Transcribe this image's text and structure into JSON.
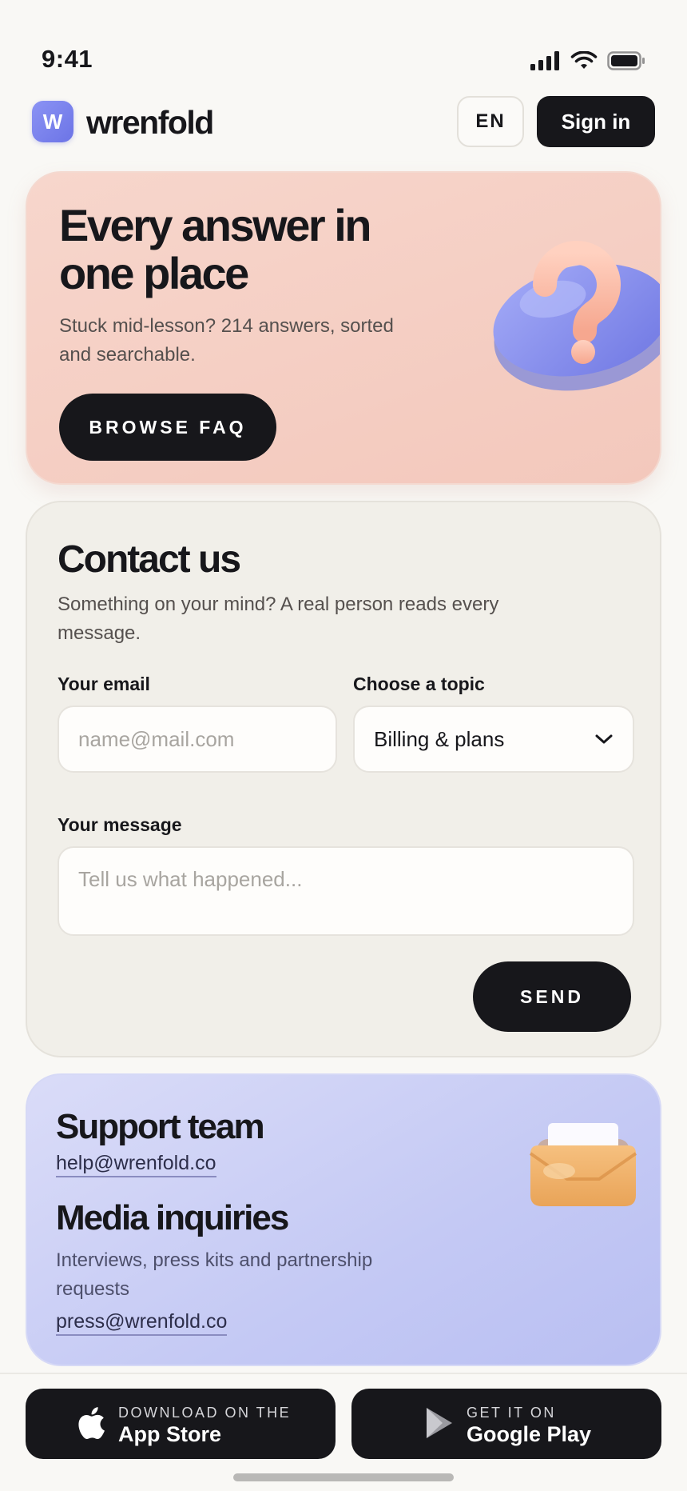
{
  "status_bar": {
    "time": "9:41"
  },
  "header": {
    "logo_letter": "W",
    "brand": "wrenfold",
    "language": "EN",
    "sign_in_label": "Sign in"
  },
  "hero": {
    "title": "Every answer in one place",
    "subtitle": "Stuck mid-lesson? 214 answers, sorted and searchable.",
    "cta_label": "BROWSE FAQ",
    "illustration": "question-bubble-icon"
  },
  "contact": {
    "title": "Contact us",
    "subtitle": "Something on your mind? A real person reads every message.",
    "email_label": "Your email",
    "email_placeholder": "name@mail.com",
    "topic_label": "Choose a topic",
    "topic_selected": "Billing & plans",
    "message_label": "Your message",
    "message_placeholder": "Tell us what happened...",
    "send_label": "SEND"
  },
  "support": {
    "title": "Support team",
    "email": "help@wrenfold.co",
    "media_title": "Media inquiries",
    "media_subtitle": "Interviews, press kits and partnership requests",
    "press_email": "press@wrenfold.co",
    "illustration": "inbox-tray-icon"
  },
  "footer": {
    "app_store_small": "DOWNLOAD ON THE",
    "app_store_big": "App Store",
    "google_play_small": "GET IT ON",
    "google_play_big": "Google Play"
  },
  "colors": {
    "background": "#f9f8f5",
    "ink": "#17171b",
    "hero_peach": "#f3c8bc",
    "contact_card": "#f1efe9",
    "support_lavender": "#c4c9f4",
    "brand_indigo": "#6c74e6"
  }
}
